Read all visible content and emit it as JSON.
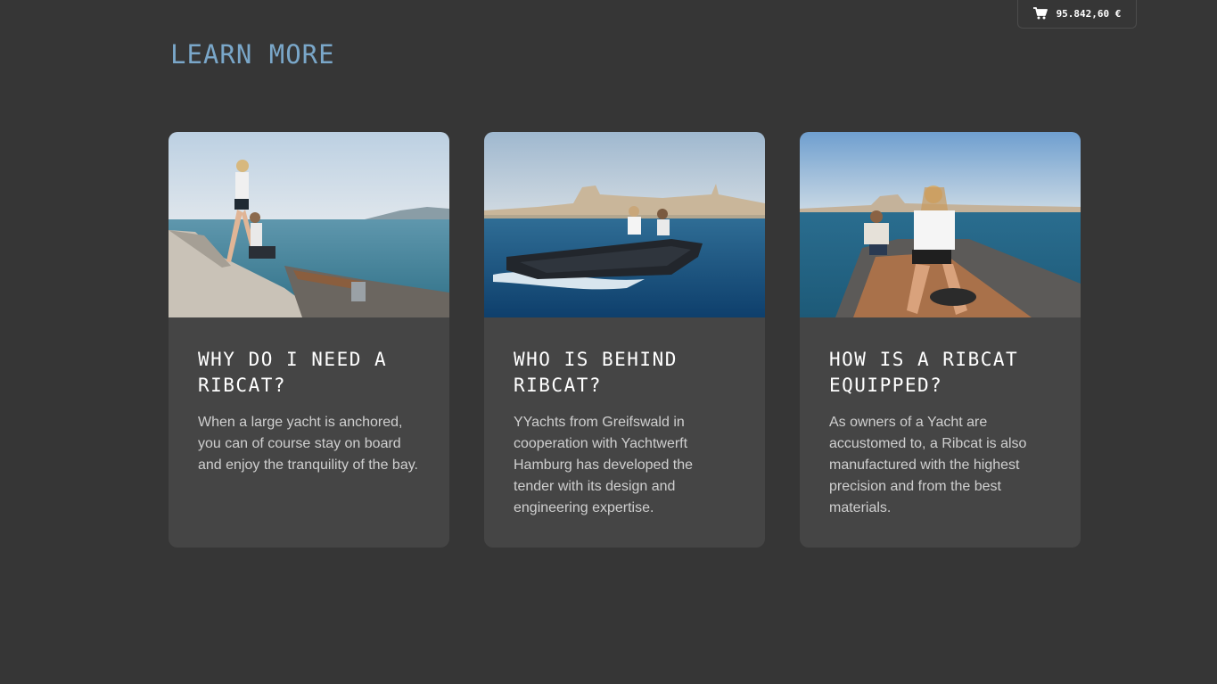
{
  "cart": {
    "icon": "shopping-cart-icon",
    "total": "95.842,60 €"
  },
  "section": {
    "title": "LEARN MORE"
  },
  "cards": [
    {
      "image": "woman-stepping-onto-tender-photo",
      "title": "WHY DO I NEED A RIBCAT?",
      "text": "When a large yacht is anchored, you can of course stay on board and enjoy the tranquility of the bay."
    },
    {
      "image": "tender-cruising-bay-photo",
      "title": "WHO IS BEHIND RIBCAT?",
      "text": "YYachts from Greifswald in cooperation with Yachtwerft Hamburg has developed the tender with its design and engineering expertise."
    },
    {
      "image": "woman-steering-tender-photo",
      "title": "HOW IS A RIBCAT EQUIPPED?",
      "text": "As owners of a Yacht are accustomed to, a Ribcat is also manufactured with the highest precision and from the best materials."
    }
  ],
  "colors": {
    "background": "#363636",
    "card": "#454545",
    "accent": "#7aa7c9"
  }
}
